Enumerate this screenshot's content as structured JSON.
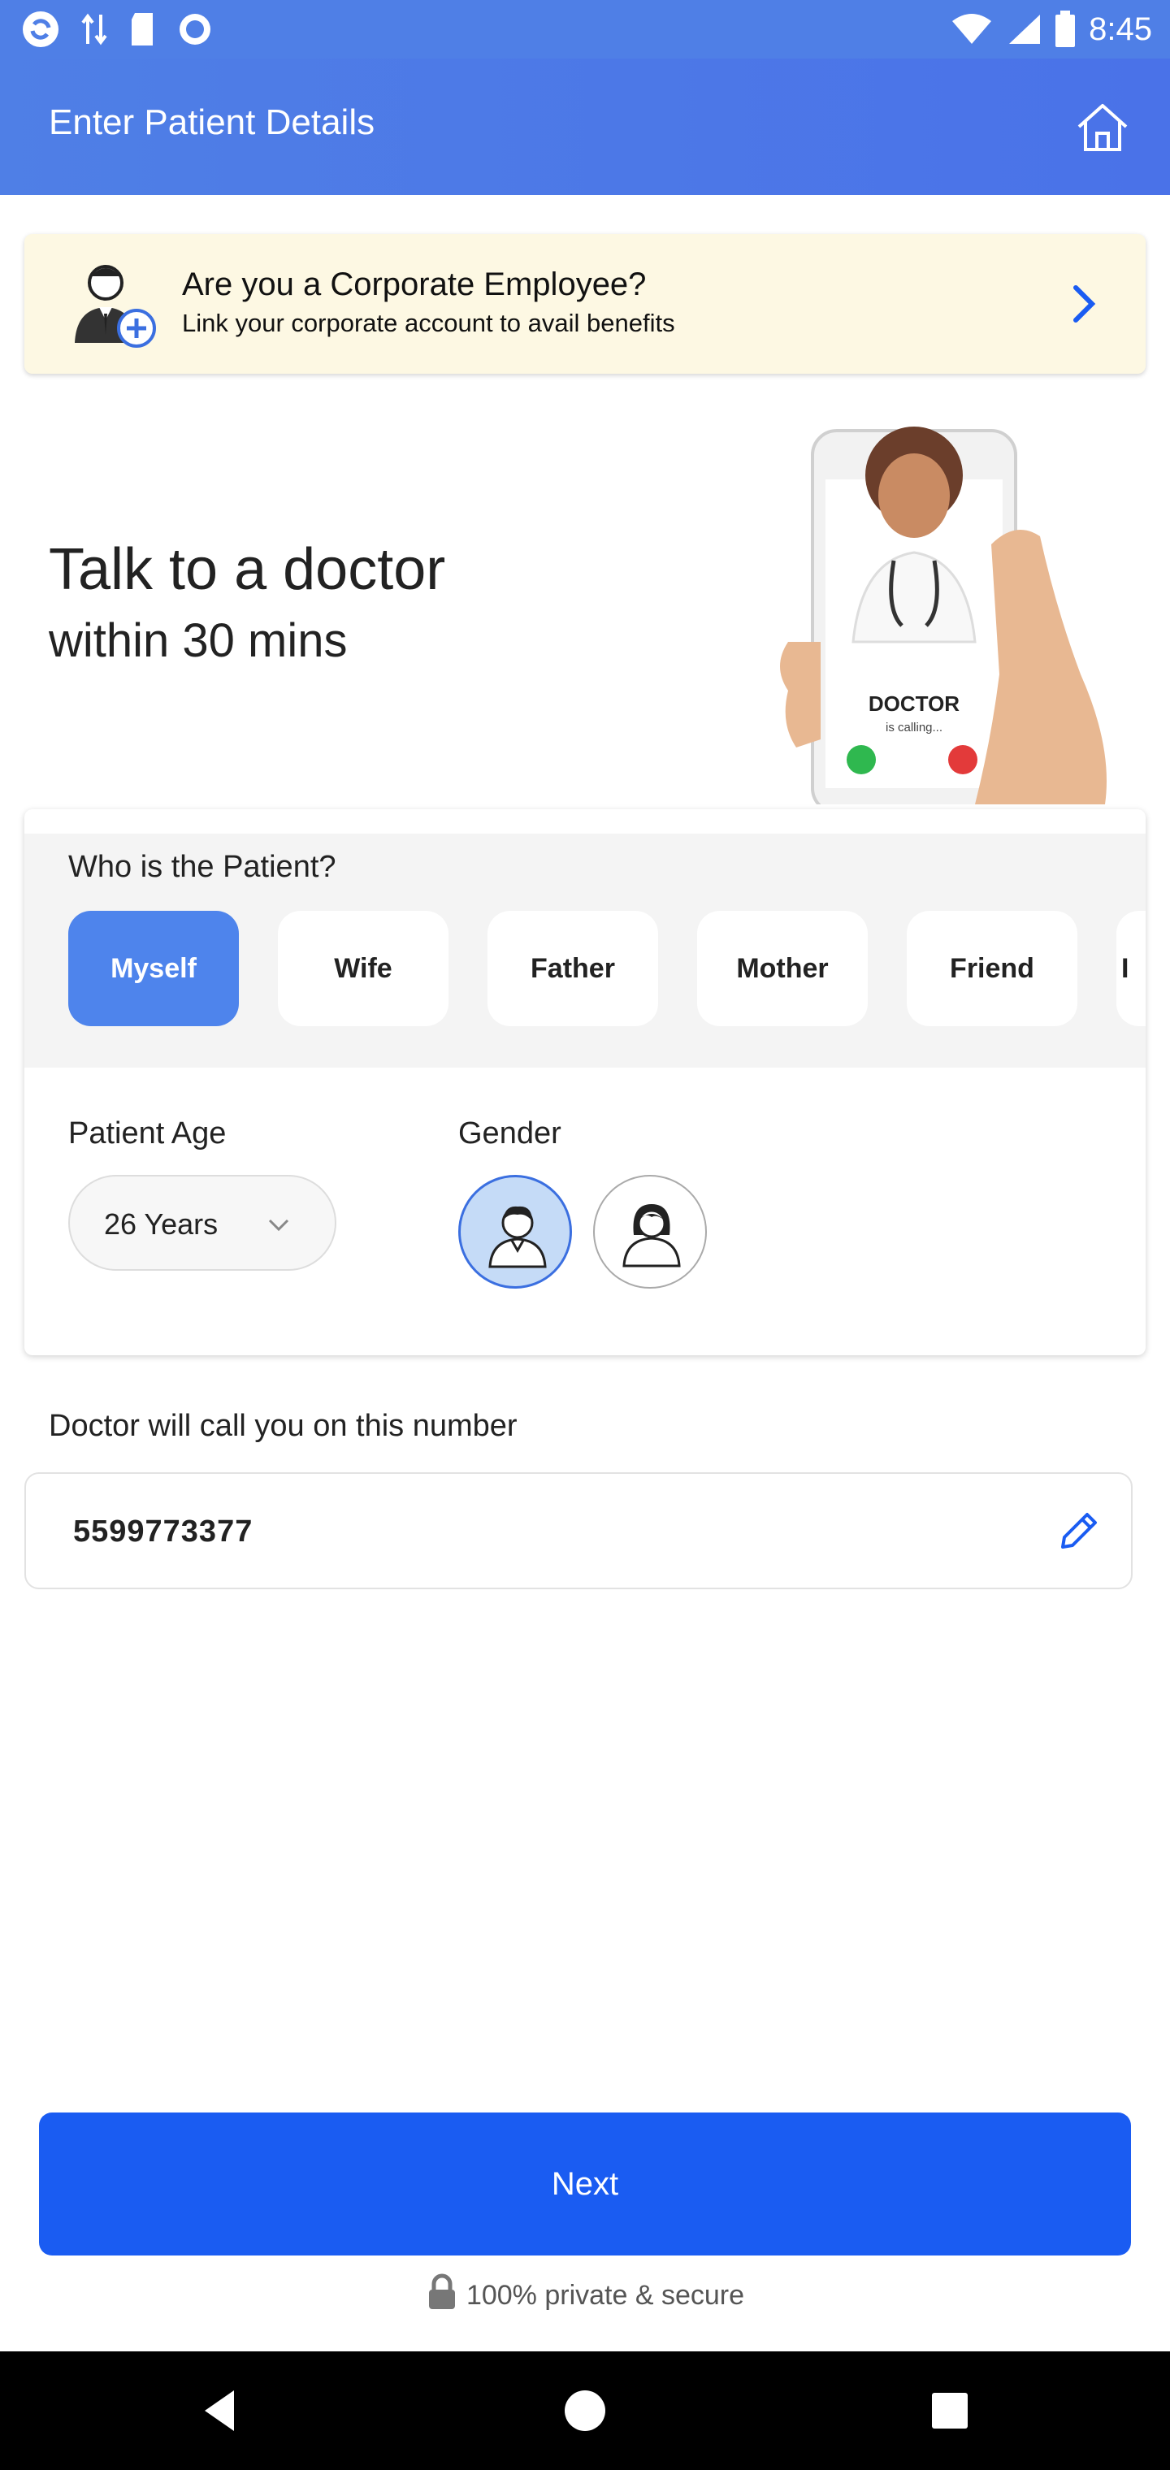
{
  "status_bar": {
    "time": "8:45",
    "icons": [
      "sync-icon",
      "data-arrows-icon",
      "sd-card-icon",
      "record-icon",
      "wifi-icon",
      "signal-icon",
      "battery-icon"
    ]
  },
  "app_bar": {
    "title": "Enter Patient Details",
    "home_icon": "home-icon"
  },
  "corporate_banner": {
    "title": "Are you a Corporate Employee?",
    "subtitle": "Link your corporate account to avail benefits",
    "icon": "corporate-user-add-icon"
  },
  "hero": {
    "headline": "Talk to a doctor",
    "subheadline": "within 30 mins",
    "illustration": {
      "caption": "DOCTOR",
      "subcaption": "is calling..."
    }
  },
  "patient": {
    "label": "Who is the Patient?",
    "options": [
      "Myself",
      "Wife",
      "Father",
      "Mother",
      "Friend",
      "I"
    ],
    "selected": "Myself",
    "age_label": "Patient Age",
    "age_value": "26 Years",
    "gender_label": "Gender",
    "gender_selected": "male"
  },
  "phone": {
    "label": "Doctor will call you on this number",
    "number": "5599773377"
  },
  "footer": {
    "next_label": "Next",
    "secure_text": "100% private & secure"
  },
  "colors": {
    "primary": "#1a5cf2",
    "app_bar": "#4f7fe6",
    "chip_active": "#4e84ec",
    "banner_bg": "#fdf8e3"
  }
}
